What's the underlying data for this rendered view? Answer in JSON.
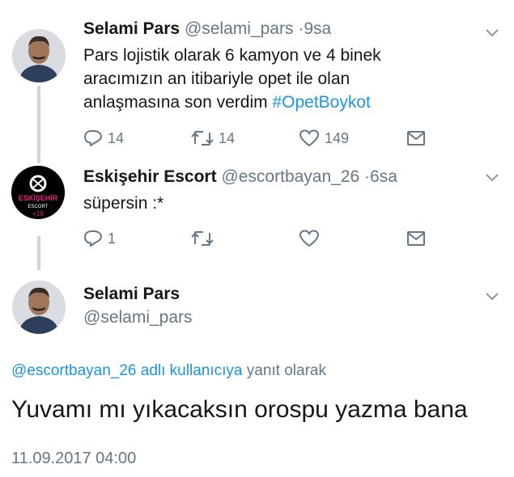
{
  "tweets": [
    {
      "name": "Selami Pars",
      "handle": "@selami_pars",
      "time": "9sa",
      "text_lines": [
        "Pars lojistik olarak 6  kamyon ve 4 binek",
        "aracımızın an itibariyle opet ile olan",
        "anlaşmasına son verdim "
      ],
      "hashtag": "#OpetBoykot",
      "replies": "14",
      "retweets": "14",
      "likes": "149"
    },
    {
      "name": "Eskişehir Escort",
      "handle": "@escortbayan_26",
      "time": "6sa",
      "text": "süpersin :*",
      "replies": "1",
      "avatar_text": "ESKİŞEHİR",
      "avatar_sub": "ESCORT",
      "avatar_badge": "+18"
    }
  ],
  "main_tweet": {
    "name": "Selami Pars",
    "handle": "@selami_pars",
    "reply_link": "@escortbayan_26 adlı kullanıcıya",
    "reply_suffix": " yanıt olarak",
    "text": "Yuvamı mı yıkacaksın orospu yazma bana",
    "timestamp": "11.09.2017 04:00"
  },
  "colors": {
    "text": "#14171a",
    "secondary": "#657786",
    "link": "#1b95e0",
    "thread_line": "#ccd6dd"
  }
}
